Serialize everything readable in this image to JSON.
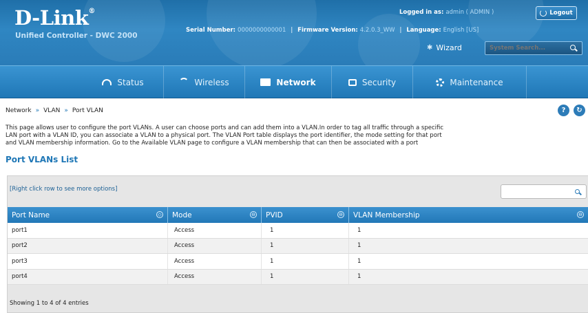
{
  "header": {
    "logo_text": "D-Link",
    "logo_reg": "®",
    "product": "Unified Controller - DWC 2000",
    "serial_label": "Serial Number:",
    "serial_value": "0000000000001",
    "firmware_label": "Firmware Version:",
    "firmware_value": "4.2.0.3_WW",
    "language_label": "Language:",
    "language_value": "English [US]",
    "logged_label": "Logged in as:",
    "logged_value": "admin ( ADMIN )",
    "logout_label": "Logout",
    "wizard_label": "Wizard",
    "system_search_placeholder": "System Search...",
    "sep": "|"
  },
  "nav": {
    "items": [
      {
        "label": "Status",
        "icon": "status-icon"
      },
      {
        "label": "Wireless",
        "icon": "wifi-icon"
      },
      {
        "label": "Network",
        "icon": "network-icon",
        "active": true
      },
      {
        "label": "Security",
        "icon": "lock-icon"
      },
      {
        "label": "Maintenance",
        "icon": "gear-icon"
      }
    ]
  },
  "breadcrumb": {
    "items": [
      "Network",
      "VLAN",
      "Port VLAN"
    ],
    "arrow": "»"
  },
  "help_label": "?",
  "refresh_label": "↻",
  "description": {
    "line1": "This page allows user to configure the port VLANs. A user can choose ports and can add them into a VLAN.In order to tag all traffic through a specific",
    "line2": "LAN port with a VLAN ID, you can associate a VLAN to a physical port. The VLAN Port table displays the port identifier, the mode setting for that port",
    "line3": "and VLAN membership information. Go to the Available VLAN page to configure a VLAN membership that can then be associated with a port"
  },
  "section_title": "Port VLANs List",
  "table": {
    "hint": "[Right click row to see more options]",
    "search_value": "",
    "columns": [
      "Port Name",
      "Mode",
      "PVID",
      "VLAN Membership"
    ],
    "sort_glyphs": [
      "◇",
      "⊖",
      "⊖",
      "⊖"
    ],
    "rows": [
      {
        "port": "port1",
        "mode": "Access",
        "pvid": "1",
        "membership": "1"
      },
      {
        "port": "port2",
        "mode": "Access",
        "pvid": "1",
        "membership": "1"
      },
      {
        "port": "port3",
        "mode": "Access",
        "pvid": "1",
        "membership": "1"
      },
      {
        "port": "port4",
        "mode": "Access",
        "pvid": "1",
        "membership": "1"
      }
    ],
    "status": "Showing 1 to 4 of 4 entries"
  },
  "colors": {
    "brand_blue": "#1f77b6",
    "header_blue": "#2f86c2",
    "accent_text": "#b5dcf6"
  }
}
